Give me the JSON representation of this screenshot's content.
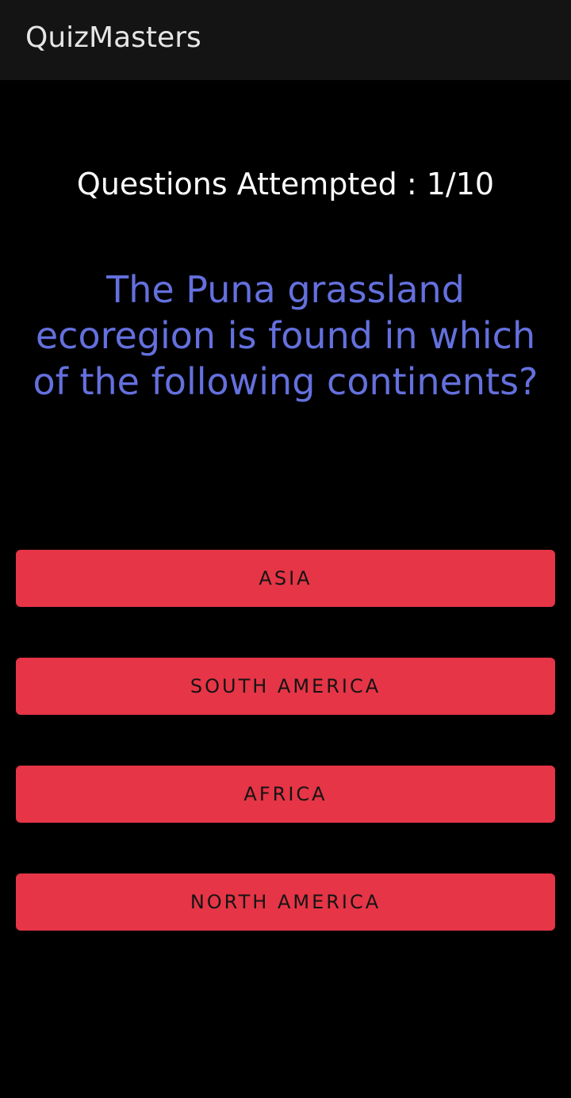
{
  "app_bar": {
    "title": "QuizMasters"
  },
  "quiz": {
    "progress_text": "Questions Attempted : 1/10",
    "question": "The Puna grassland ecoregion is found in which of the following continents?",
    "options": [
      {
        "label": "ASIA"
      },
      {
        "label": "SOUTH AMERICA"
      },
      {
        "label": "AFRICA"
      },
      {
        "label": "NORTH AMERICA"
      }
    ]
  },
  "colors": {
    "background": "#000000",
    "app_bar": "#141414",
    "question_text": "#6470dd",
    "button": "#e63546"
  }
}
